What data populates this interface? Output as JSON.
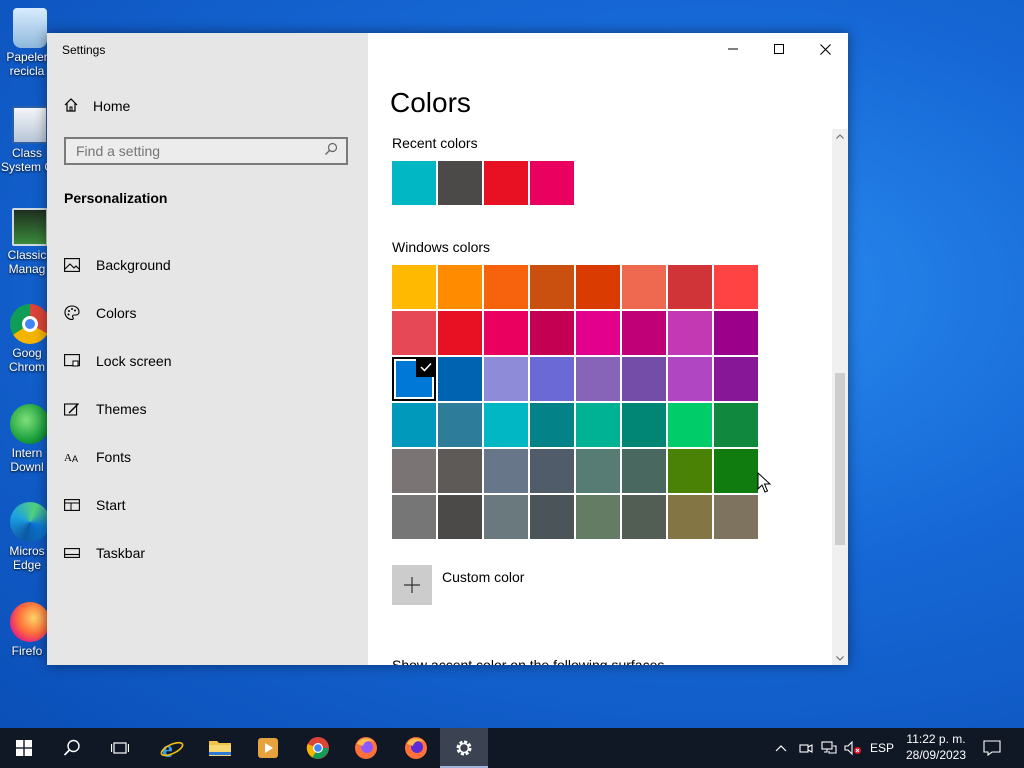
{
  "desktop": {
    "icons": [
      {
        "name": "recycle-bin",
        "label": "Papeler\nrecicla",
        "color": "#b9d7ef"
      },
      {
        "name": "classic-system-config",
        "label": "Class\nSystem C",
        "color": "#dfe6ee"
      },
      {
        "name": "classic-manager",
        "label": "Classic\nManag",
        "color": "#3a8a3a"
      },
      {
        "name": "google-chrome",
        "label": "Goog\nChrom",
        "color": "#db4437"
      },
      {
        "name": "internet-download",
        "label": "Intern\nDownl",
        "color": "#1a9f3d"
      },
      {
        "name": "microsoft-edge",
        "label": "Micros\nEdge",
        "color": "#0c7ad8"
      },
      {
        "name": "firefox",
        "label": "Firefo",
        "color": "#ff7139"
      }
    ]
  },
  "window": {
    "title": "Settings"
  },
  "sidebar": {
    "home_label": "Home",
    "search_placeholder": "Find a setting",
    "section_title": "Personalization",
    "items": [
      {
        "label": "Background",
        "icon": "picture-icon"
      },
      {
        "label": "Colors",
        "icon": "palette-icon"
      },
      {
        "label": "Lock screen",
        "icon": "lock-screen-icon"
      },
      {
        "label": "Themes",
        "icon": "themes-icon"
      },
      {
        "label": "Fonts",
        "icon": "fonts-icon"
      },
      {
        "label": "Start",
        "icon": "start-icon"
      },
      {
        "label": "Taskbar",
        "icon": "taskbar-icon"
      }
    ]
  },
  "content": {
    "title": "Colors",
    "recent_label": "Recent colors",
    "recent_colors": [
      "#00b7c3",
      "#4c4a48",
      "#e81123",
      "#ea005e"
    ],
    "windows_label": "Windows colors",
    "windows_colors": [
      "#ffb900",
      "#ff8c00",
      "#f7630c",
      "#ca5010",
      "#da3b01",
      "#ef6950",
      "#d13438",
      "#ff4343",
      "#e74856",
      "#e81123",
      "#ea005e",
      "#c30052",
      "#e3008c",
      "#bf0077",
      "#c239b3",
      "#9a0089",
      "#0078d7",
      "#0063b1",
      "#8e8cd8",
      "#6b69d6",
      "#8764b8",
      "#744da9",
      "#b146c2",
      "#881798",
      "#0099bc",
      "#2d7d9a",
      "#00b7c3",
      "#038387",
      "#00b294",
      "#018574",
      "#00cc6a",
      "#10893e",
      "#7a7574",
      "#5d5a58",
      "#68768a",
      "#515c6b",
      "#567c73",
      "#486860",
      "#498205",
      "#107c10",
      "#767676",
      "#4c4a48",
      "#69797e",
      "#4a5459",
      "#647c64",
      "#525e54",
      "#847545",
      "#7e735f"
    ],
    "selected_color": "#0078d7",
    "custom_color_label": "Custom color",
    "show_accent_label": "Show accent color on the following surfaces"
  },
  "taskbar": {
    "apps": [
      "start-icon",
      "search-icon",
      "task-view-icon",
      "internet-explorer-icon",
      "file-explorer-icon",
      "media-player-icon",
      "chrome-icon",
      "firefox-icon",
      "firefox-dev-icon",
      "settings-icon"
    ],
    "language": "ESP",
    "time": "11:22 p. m.",
    "date": "28/09/2023"
  }
}
